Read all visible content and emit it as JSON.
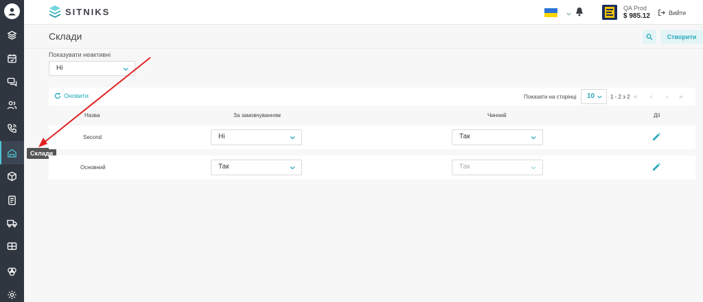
{
  "app": {
    "brand": "SITNIKS"
  },
  "header": {
    "account_name": "QA Prod",
    "balance": "$ 985.12",
    "logout_label": "Вийти"
  },
  "sidebar": {
    "tooltip": "Склади",
    "items": [
      {
        "icon": "layers-icon"
      },
      {
        "icon": "calendar-icon"
      },
      {
        "icon": "chat-icon"
      },
      {
        "icon": "users-icon"
      },
      {
        "icon": "phone-icon"
      },
      {
        "icon": "warehouse-icon",
        "active": true
      },
      {
        "icon": "box-icon"
      },
      {
        "icon": "document-icon"
      },
      {
        "icon": "truck-icon"
      },
      {
        "icon": "wallet-icon"
      },
      {
        "icon": "integrations-icon"
      },
      {
        "icon": "settings-icon"
      }
    ]
  },
  "page": {
    "title": "Склади",
    "create_label": "Створити",
    "filter_label": "Показувати неактивні",
    "filter_value": "Ні"
  },
  "table": {
    "refresh_label": "Оновити",
    "per_page_label": "Показати на сторінці",
    "per_page_value": "10",
    "range_label": "1 - 2 з 2",
    "columns": {
      "name": "Назва",
      "default": "За замовчуванням",
      "active": "Чинний",
      "actions": "Дії"
    },
    "rows": [
      {
        "name": "Second",
        "default": "Ні",
        "active": "Так",
        "active_disabled": false
      },
      {
        "name": "Основний",
        "default": "Так",
        "active": "Так",
        "active_disabled": true
      }
    ]
  },
  "colors": {
    "accent": "#2aa8b8",
    "sidebar": "#2f3640",
    "annotation_arrow": "#e02020"
  }
}
